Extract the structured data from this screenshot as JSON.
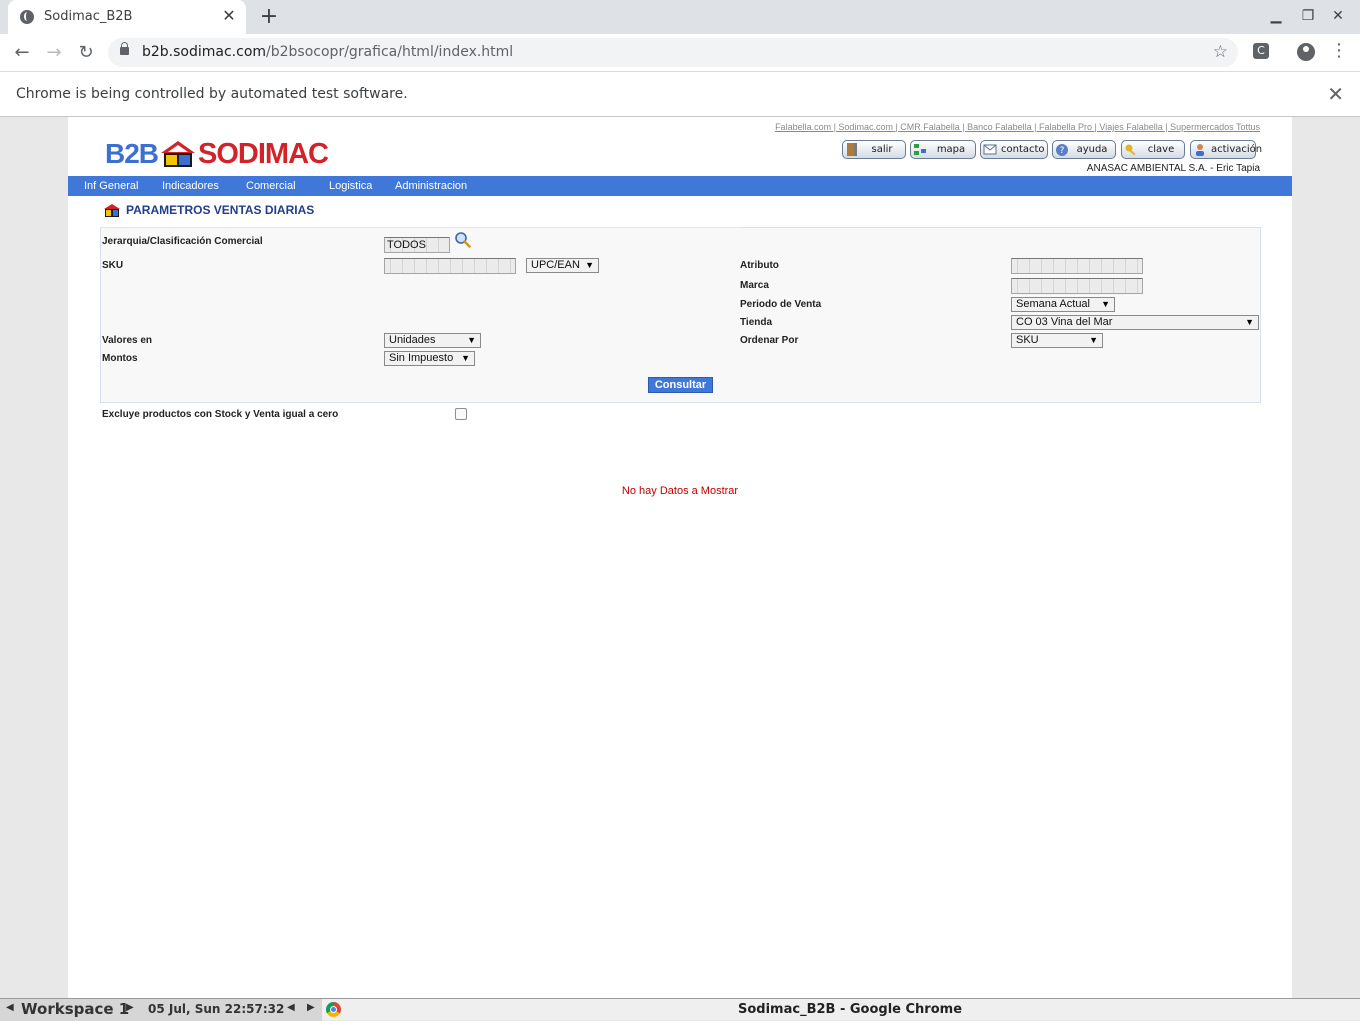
{
  "browser": {
    "tab_title": "Sodimac_B2B",
    "url_host": "b2b.sodimac.com",
    "url_path": "/b2bsocopr/grafica/html/index.html",
    "infobar_message": "Chrome is being controlled by automated test software."
  },
  "header": {
    "top_links": "Falabella.com | Sodimac.com | CMR Falabella | Banco Falabella | Falabella Pro | Viajes Falabella | Supermercados Tottus",
    "logo_b2b": "B2B",
    "logo_brand": "SODIMAC",
    "buttons": [
      {
        "label": "salir",
        "icon": "door-exit-icon"
      },
      {
        "label": "mapa",
        "icon": "sitemap-icon"
      },
      {
        "label": "contacto",
        "icon": "envelope-icon"
      },
      {
        "label": "ayuda",
        "icon": "help-icon"
      },
      {
        "label": "clave",
        "icon": "key-icon"
      },
      {
        "label": "activación",
        "icon": "user-activation-icon"
      }
    ],
    "company_user": "ANASAC AMBIENTAL S.A. - Eric Tapia"
  },
  "nav": {
    "items": [
      "Inf General",
      "Indicadores",
      "Comercial",
      "Logistica",
      "Administracion"
    ]
  },
  "section": {
    "title": "PARAMETROS VENTAS DIARIAS"
  },
  "form": {
    "jerarquia_label": "Jerarquia/Clasificación Comercial",
    "jerarquia_value": "TODOS",
    "sku_label": "SKU",
    "sku_value": "",
    "sku_type_selected": "UPC/EAN",
    "atributo_label": "Atributo",
    "atributo_value": "",
    "marca_label": "Marca",
    "marca_value": "",
    "periodo_label": "Periodo de Venta",
    "periodo_selected": "Semana Actual",
    "tienda_label": "Tienda",
    "tienda_selected": "CO 03 Vina del Mar",
    "valores_label": "Valores en",
    "valores_selected": "Unidades",
    "ordenar_label": "Ordenar Por",
    "ordenar_selected": "SKU",
    "montos_label": "Montos",
    "montos_selected": "Sin Impuesto",
    "consultar_label": "Consultar",
    "excluye_label": "Excluye productos con Stock y Venta igual a cero",
    "excluye_checked": false
  },
  "results": {
    "message": "No hay Datos a Mostrar"
  },
  "taskbar": {
    "workspace": "Workspace 1",
    "datetime": "05 Jul, Sun 22:57:32",
    "window_title": "Sodimac_B2B - Google Chrome"
  },
  "colors": {
    "nav_blue": "#3f78d8",
    "brand_red": "#d3232a",
    "title_blue": "#213e8c",
    "error_red": "#c00000"
  }
}
